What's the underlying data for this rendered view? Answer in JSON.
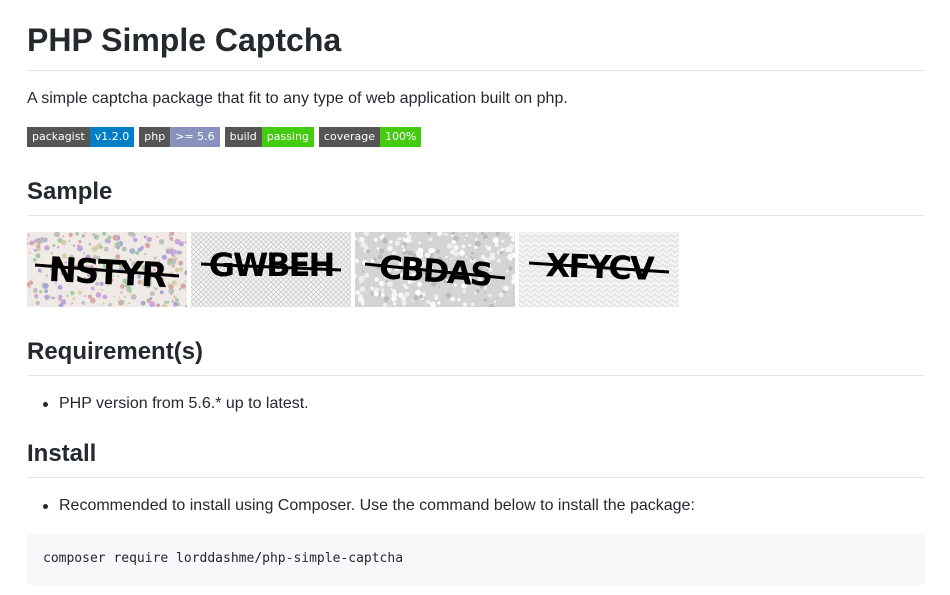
{
  "title": "PHP Simple Captcha",
  "description": "A simple captcha package that fit to any type of web application built on php.",
  "badges": [
    {
      "label": "packagist",
      "value": "v1.2.0",
      "color": "#007ec6"
    },
    {
      "label": "php",
      "value": ">= 5.6",
      "color": "#8892bf"
    },
    {
      "label": "build",
      "value": "passing",
      "color": "#4c1"
    },
    {
      "label": "coverage",
      "value": "100%",
      "color": "#4c1"
    }
  ],
  "sample": {
    "heading": "Sample",
    "captchas": [
      {
        "text": "NSTYR",
        "style": "confetti"
      },
      {
        "text": "GWBEH",
        "style": "crosshatch"
      },
      {
        "text": "CBDAS",
        "style": "blotch"
      },
      {
        "text": "XFYCV",
        "style": "wave"
      }
    ]
  },
  "requirements": {
    "heading": "Requirement(s)",
    "items": [
      "PHP version from 5.6.* up to latest."
    ]
  },
  "install": {
    "heading": "Install",
    "items": [
      "Recommended to install using Composer. Use the command below to install the package:"
    ],
    "command": "composer require lorddashme/php-simple-captcha"
  }
}
